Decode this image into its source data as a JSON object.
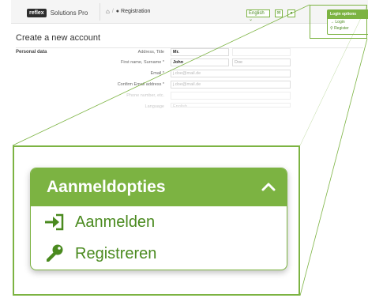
{
  "app": {
    "logo_badge": "reflex",
    "logo_text": "Solutions Pro",
    "breadcrumb": "Registration"
  },
  "header_controls": {
    "language": "English",
    "language_chevron": "chevron-down-icon",
    "mail_icon": "mail-icon",
    "user_icon": "user-icon"
  },
  "page": {
    "title": "Create a new account",
    "section": "Personal data"
  },
  "form": {
    "address_title": {
      "label": "Address, Title",
      "value": "Mr."
    },
    "name": {
      "label": "First name, Surname *",
      "first": "John",
      "last": "Doe"
    },
    "email": {
      "label": "Email *",
      "value": "j.doe@mail.de"
    },
    "email_confirm": {
      "label": "Confirm Email address *",
      "value": "j.doe@mail.de"
    },
    "phone": {
      "label": "Phone number, etc.",
      "value": ""
    },
    "language": {
      "label": "Language",
      "value": "English"
    }
  },
  "login_panel_small": {
    "header": "Login options",
    "items": [
      "Login",
      "Register"
    ]
  },
  "login_panel_zoom": {
    "header": "Aanmeldopties",
    "items": [
      {
        "label": "Aanmelden",
        "icon": "login-arrow-icon"
      },
      {
        "label": "Registreren",
        "icon": "key-icon"
      }
    ]
  },
  "colors": {
    "accent": "#7cb342",
    "accent_dark": "#4a8a1f"
  }
}
